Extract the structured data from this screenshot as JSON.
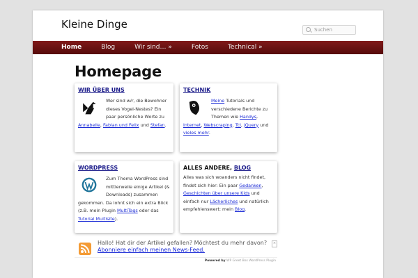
{
  "site": {
    "title": "Kleine Dinge"
  },
  "search": {
    "placeholder": "Suchen"
  },
  "nav": {
    "items": [
      "Home",
      "Blog",
      "Wir sind… »",
      "Fotos",
      "Technical »"
    ]
  },
  "page": {
    "heading": "Homepage"
  },
  "cards": {
    "wir": {
      "title": "WIR ÜBER UNS",
      "t1": "Wer sind ",
      "t1em": "wir",
      "t2": ", die Bewohner dieses Vogel-Nestes? Ein paar persönliche Worte zu ",
      "l1": "Annabelle",
      "t3": ", ",
      "l2": "Fabian und Felix",
      "t4": " und ",
      "l3": "Stefan",
      "t5": "."
    },
    "technik": {
      "title": "TECHNIK",
      "l1": "Meine",
      "t1": " Tutorials und verschiedene Berichte zu Themen wie ",
      "l2": "Handys",
      "t2": ", ",
      "l3": "Internet",
      "t3": ", ",
      "l4": "Webscraping",
      "t4": ", ",
      "l5": "Tcl",
      "t5": ", ",
      "l6": "jQuery",
      "t6": " und ",
      "l7": "vieles mehr",
      "t7": "."
    },
    "wordpress": {
      "title": "WORDPRESS",
      "t1": "Zum Thema WordPress sind mittlerweile einige Artikel (& Downloads) zusammen gekommen. Da lohnt sich ein extra Blick (z.B. mein Plugin ",
      "l1": "MultiTags",
      "t2": " oder das ",
      "l2": "Tutorial Multisite",
      "t3": ")."
    },
    "alles": {
      "title_pre": "ALLES ANDERE, ",
      "title_link": "BLOG",
      "t1": "Alles was sich woanders nicht findet, findet sich hier: Ein paar ",
      "l1": "Gedanken",
      "t2": ", ",
      "l2": "Geschichten über unsere Kids",
      "t3": " und einfach nur ",
      "l3": "Lächerliches",
      "t4": " und natürlich empfehlenswert: mein ",
      "l4": "Blog",
      "t5": "."
    }
  },
  "feed": {
    "text": "Hallo! Hat dir der Artikel gefallen? Möchtest du mehr davon?",
    "link": "Abonniere einfach meinen News-Feed.",
    "powered_label": "Powered by",
    "powered_by": "WP Greet Box WordPress Plugin"
  }
}
